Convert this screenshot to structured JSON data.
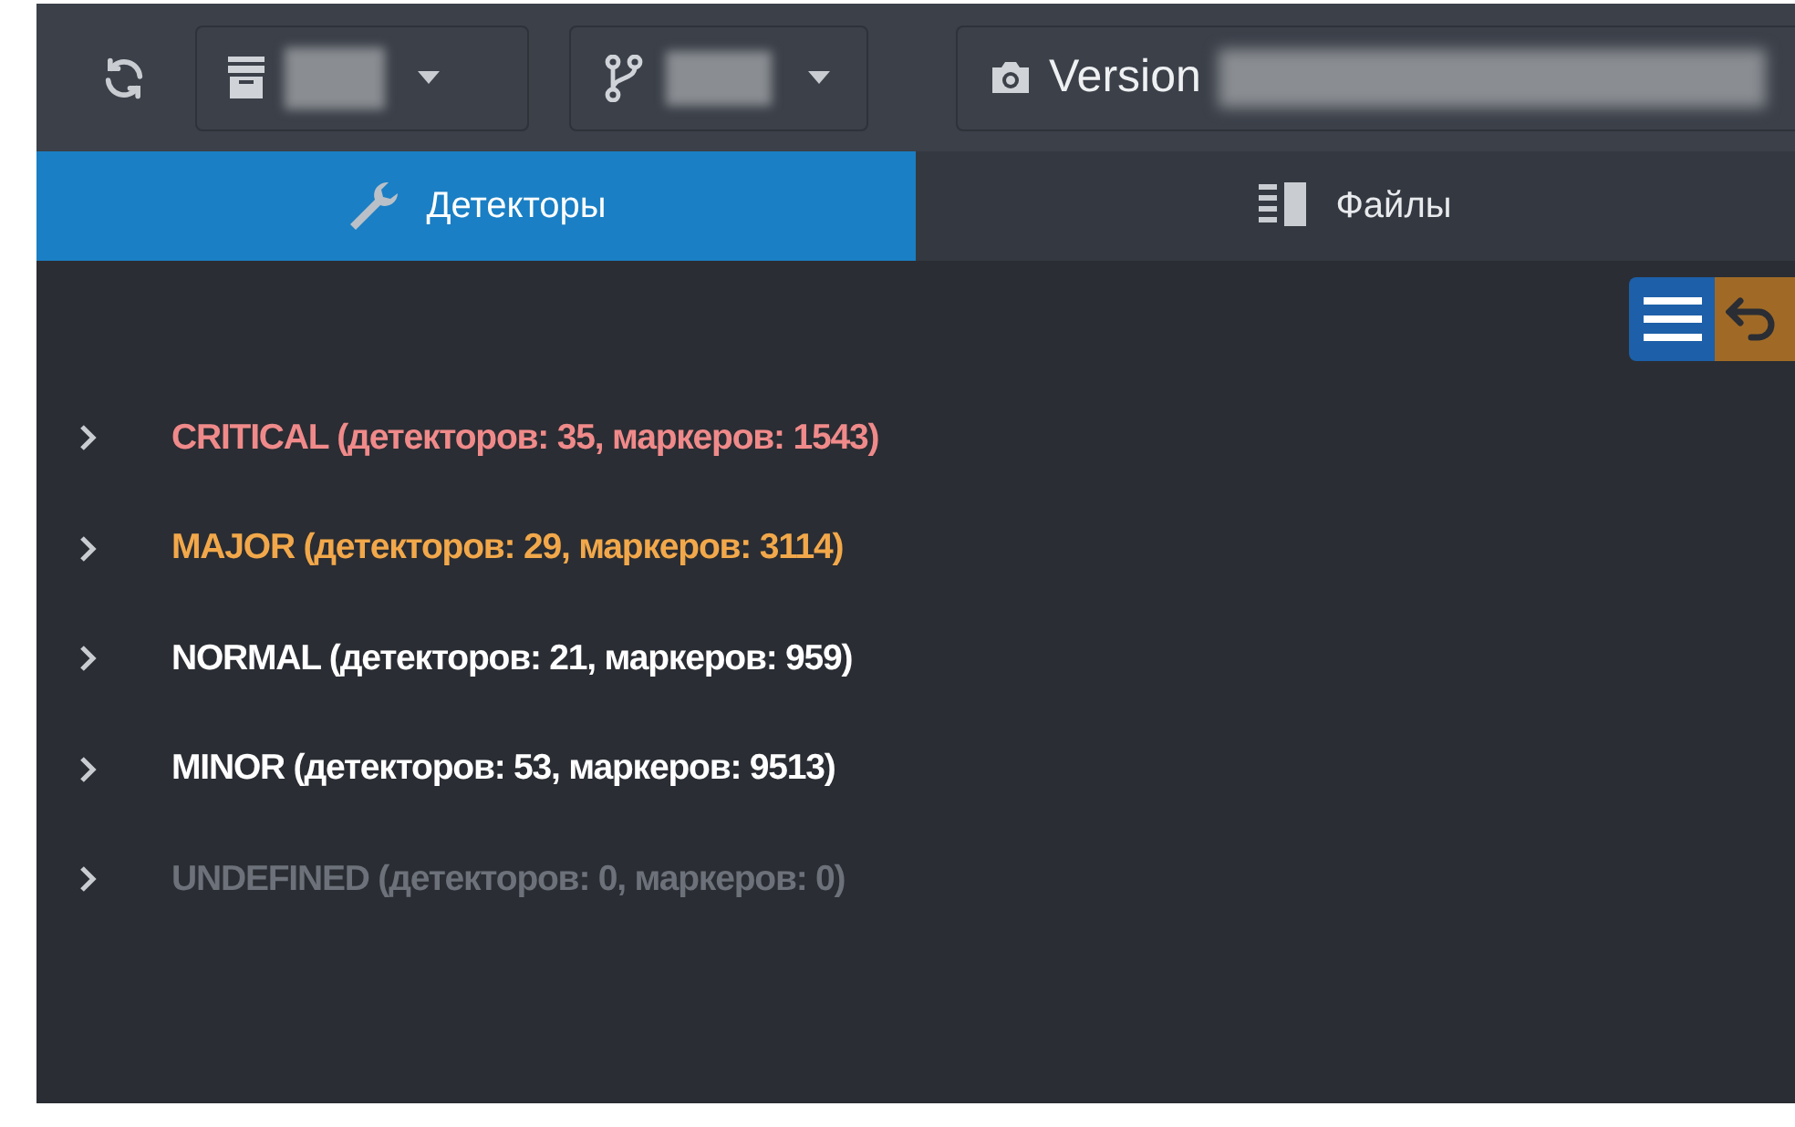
{
  "toolbar": {
    "version_label": "Version"
  },
  "tabs": [
    {
      "label": "Детекторы",
      "selected": true
    },
    {
      "label": "Файлы",
      "selected": false
    }
  ],
  "groups": [
    {
      "label": "CRITICAL (детекторов: 35, маркеров: 1543)",
      "color": "#f08a8a",
      "expanded": false
    },
    {
      "label": "MAJOR (детекторов: 29, маркеров: 3114)",
      "color": "#f2a84a",
      "expanded": false
    },
    {
      "label": "NORMAL (детекторов: 21, маркеров: 959)",
      "color": "#ffffff",
      "expanded": false
    },
    {
      "label": "MINOR (детекторов: 53, маркеров: 9513)",
      "color": "#ffffff",
      "expanded": false
    },
    {
      "label": "UNDEFINED (детекторов: 0, маркеров: 0)",
      "color": "#6c717a",
      "expanded": false
    }
  ]
}
